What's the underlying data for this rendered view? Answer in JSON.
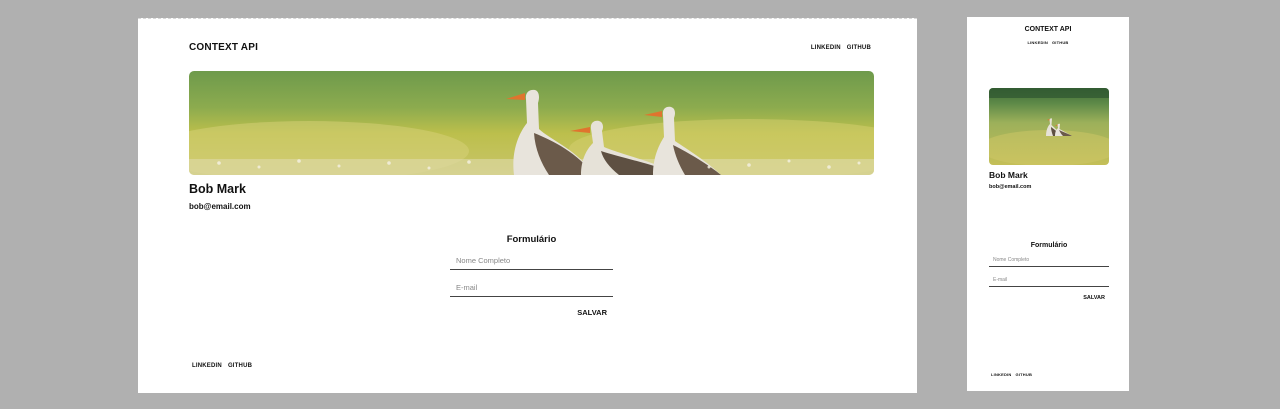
{
  "desktop": {
    "brand": "CONTEXT API",
    "nav": {
      "linkedin": "LINKEDIN",
      "github": "GITHUB"
    },
    "banner": {
      "icon": "geese-in-meadow-image"
    },
    "profile": {
      "name": "Bob Mark",
      "email": "bob@email.com"
    },
    "form": {
      "title": "Formulário",
      "name_placeholder": "Nome Completo",
      "email_placeholder": "E-mail",
      "save_label": "SALVAR"
    },
    "footer": {
      "linkedin": "LINKEDIN",
      "github": "GITHUB"
    }
  },
  "mobile": {
    "brand": "CONTEXT API",
    "nav": {
      "linkedin": "LINKEDIN",
      "github": "GITHUB"
    },
    "banner": {
      "icon": "geese-in-meadow-image"
    },
    "profile": {
      "name": "Bob Mark",
      "email": "bob@email.com"
    },
    "form": {
      "title": "Formulário",
      "name_placeholder": "Nome Completo",
      "email_placeholder": "E-mail",
      "save_label": "SALVAR"
    },
    "footer": {
      "linkedin": "LINKEDIN",
      "github": "GITHUB"
    }
  },
  "colors": {
    "background": "#b0b0b0",
    "surface": "#ffffff",
    "text": "#111111",
    "meadow": "#b8b84a",
    "meadow_dark": "#6f8f3c"
  }
}
